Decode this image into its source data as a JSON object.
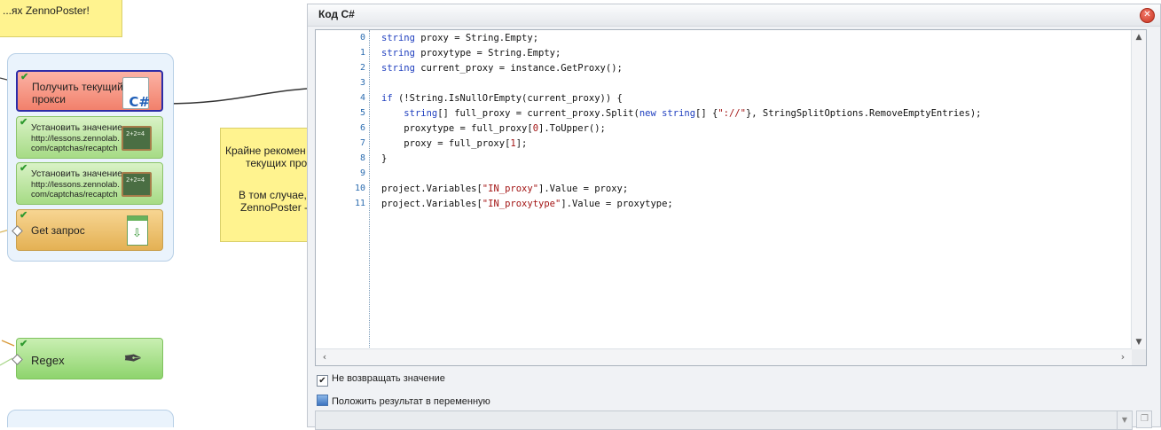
{
  "canvas": {
    "note_top": {
      "lines": [
        "...ях ZennoPoster!"
      ]
    },
    "note_mid": {
      "lines": [
        "Крайне рекомен",
        "текущих прок",
        "В том случае,",
        "ZennoPoster -"
      ]
    },
    "actions": [
      {
        "label_lines": [
          "Получить текущий",
          "прокси"
        ]
      },
      {
        "label_lines": [
          "Установить значение",
          "http://lessons.zennolab.",
          "com/captchas/recaptch"
        ]
      },
      {
        "label_lines": [
          "Установить значение",
          "http://lessons.zennolab.",
          "com/captchas/recaptch"
        ]
      },
      {
        "label_lines": [
          "Get запрос"
        ]
      },
      {
        "label_lines": [
          "Regex"
        ]
      }
    ],
    "icons": {
      "cs": "C#",
      "board": "2+2=4"
    }
  },
  "dialog": {
    "title": "Код C#",
    "close_label": "✕",
    "line_numbers": [
      "0",
      "1",
      "2",
      "3",
      "4",
      "5",
      "6",
      "7",
      "8",
      "9",
      "10",
      "11"
    ],
    "code": [
      [
        {
          "t": "string",
          "c": "kw"
        },
        {
          "t": " proxy = String.Empty;"
        }
      ],
      [
        {
          "t": "string",
          "c": "kw"
        },
        {
          "t": " proxytype = String.Empty;"
        }
      ],
      [
        {
          "t": "string",
          "c": "kw"
        },
        {
          "t": " current_proxy = instance.GetProxy();"
        }
      ],
      [],
      [
        {
          "t": "if",
          "c": "kw"
        },
        {
          "t": " (!String.IsNullOrEmpty(current_proxy)) {"
        }
      ],
      [
        {
          "t": "    "
        },
        {
          "t": "string",
          "c": "kw"
        },
        {
          "t": "[] full_proxy = current_proxy.Split("
        },
        {
          "t": "new",
          "c": "kw"
        },
        {
          "t": " "
        },
        {
          "t": "string",
          "c": "kw"
        },
        {
          "t": "[] {"
        },
        {
          "t": "\"://\"",
          "c": "str"
        },
        {
          "t": "}, StringSplitOptions.RemoveEmptyEntries);"
        }
      ],
      [
        {
          "t": "    proxytype = full_proxy["
        },
        {
          "t": "0",
          "c": "str"
        },
        {
          "t": "].ToUpper();"
        }
      ],
      [
        {
          "t": "    proxy = full_proxy["
        },
        {
          "t": "1",
          "c": "str"
        },
        {
          "t": "];"
        }
      ],
      [
        {
          "t": "}"
        }
      ],
      [],
      [
        {
          "t": "project.Variables["
        },
        {
          "t": "\"IN_proxy\"",
          "c": "str"
        },
        {
          "t": "].Value = proxy;"
        }
      ],
      [
        {
          "t": "project.Variables["
        },
        {
          "t": "\"IN_proxytype\"",
          "c": "str"
        },
        {
          "t": "].Value = proxytype;"
        }
      ]
    ],
    "options": {
      "no_return": {
        "label": "Не возвращать значение",
        "checked": true,
        "mark": "✔"
      },
      "put_result": {
        "label": "Положить результат в переменную",
        "checked": false
      }
    },
    "result_field": {
      "value": ""
    },
    "scroll_glyphs": {
      "up": "▲",
      "down": "▼",
      "left": "‹",
      "right": "›",
      "dropdown": "▼",
      "copy": "❐"
    }
  }
}
